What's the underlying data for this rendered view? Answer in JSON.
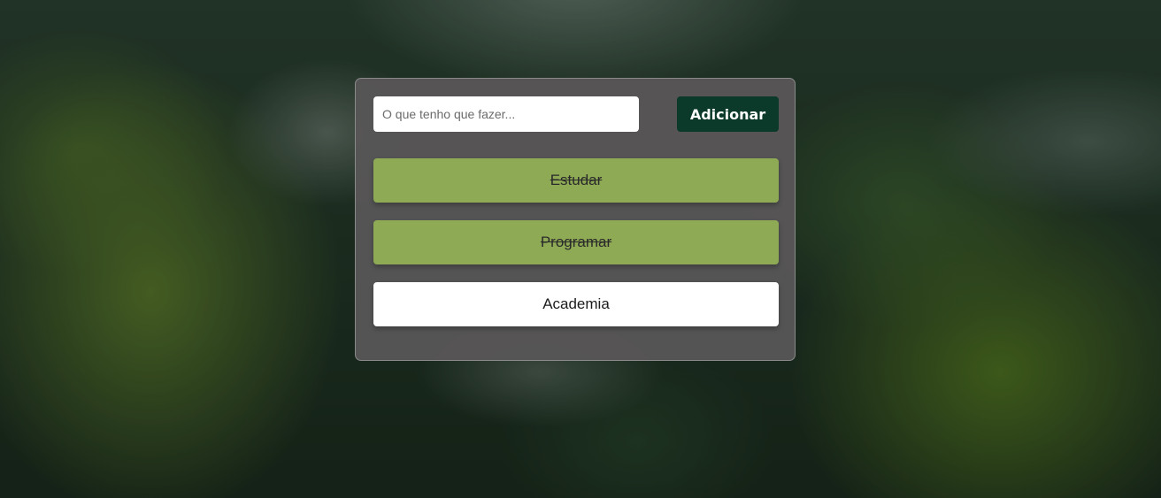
{
  "form": {
    "input_placeholder": "O que tenho que fazer...",
    "input_value": "",
    "add_button_label": "Adicionar"
  },
  "tasks": [
    {
      "label": "Estudar",
      "completed": true
    },
    {
      "label": "Programar",
      "completed": true
    },
    {
      "label": "Academia",
      "completed": false
    }
  ],
  "colors": {
    "completed_task": "#8faa55",
    "pending_task": "#ffffff",
    "add_button": "#0b3a2a",
    "card": "#585657"
  }
}
